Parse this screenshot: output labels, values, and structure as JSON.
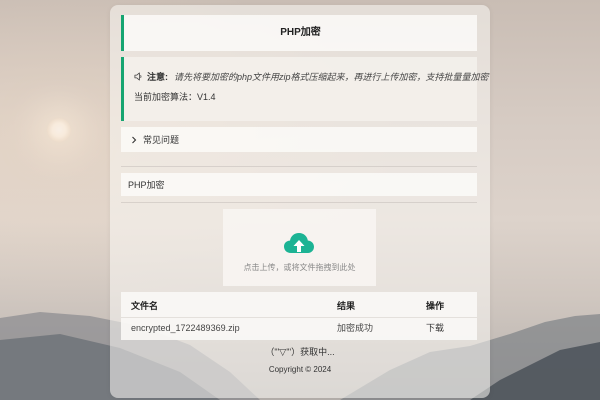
{
  "page": {
    "title": "PHP加密"
  },
  "notice": {
    "icon": "speaker-icon",
    "label": "注意:",
    "text": "请先将要加密的php文件用zip格式压缩起来，再进行上传加密，支持批量量加密",
    "algorithm": "当前加密算法：V1.4"
  },
  "faq": {
    "icon": "chevron-right-icon",
    "label": "常见问题"
  },
  "section": {
    "label": "PHP加密"
  },
  "upload": {
    "icon": "cloud-upload-icon",
    "hint": "点击上传，或将文件拖拽到此处",
    "icon_color": "#1cb394"
  },
  "table": {
    "headers": [
      "文件名",
      "结果",
      "操作"
    ],
    "rows": [
      {
        "filename": "encrypted_1722489369.zip",
        "result": "加密成功",
        "action": "下载"
      }
    ]
  },
  "status": "（\"'▽'\"）获取中...",
  "footer": {
    "copyright": "Copyright © 2024"
  },
  "colors": {
    "accent": "#16a571"
  }
}
